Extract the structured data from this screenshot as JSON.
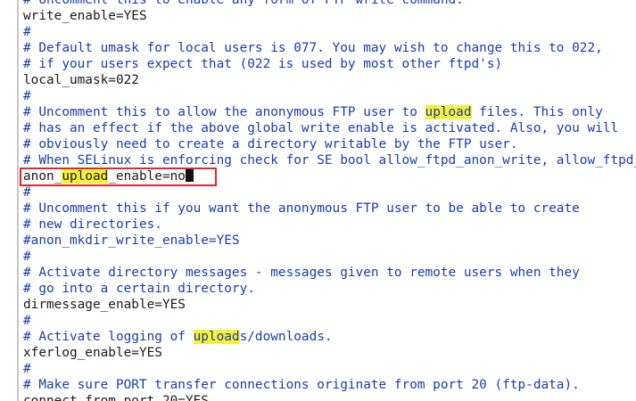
{
  "lines": [
    {
      "type": "comment",
      "segments": [
        {
          "t": "# Uncomment this to enable any form of FTP write command."
        }
      ]
    },
    {
      "type": "code",
      "segments": [
        {
          "t": "write_enable=YES"
        }
      ]
    },
    {
      "type": "comment",
      "segments": [
        {
          "t": "#"
        }
      ]
    },
    {
      "type": "comment",
      "segments": [
        {
          "t": "# Default umask for local users is 077. You may wish to change this to 022,"
        }
      ]
    },
    {
      "type": "comment",
      "segments": [
        {
          "t": "# if your users expect that (022 is used by most other ftpd's)"
        }
      ]
    },
    {
      "type": "code",
      "segments": [
        {
          "t": "local_umask=022"
        }
      ]
    },
    {
      "type": "comment",
      "segments": [
        {
          "t": "#"
        }
      ]
    },
    {
      "type": "comment",
      "segments": [
        {
          "t": "# Uncomment this to allow the anonymous FTP user to "
        },
        {
          "t": "upload",
          "hl": true
        },
        {
          "t": " files. This only"
        }
      ]
    },
    {
      "type": "comment",
      "segments": [
        {
          "t": "# has an effect if the above global write enable is activated. Also, you will"
        }
      ]
    },
    {
      "type": "comment",
      "segments": [
        {
          "t": "# obviously need to create a directory writable by the FTP user."
        }
      ]
    },
    {
      "type": "comment",
      "segments": [
        {
          "t": "# When SELinux is enforcing check for SE bool allow_ftpd_anon_write, allow_ftpd_full_access"
        }
      ]
    },
    {
      "type": "code",
      "segments": [
        {
          "t": "anon_"
        },
        {
          "t": "upload",
          "hl": true
        },
        {
          "t": "_enable=no"
        }
      ],
      "cursor": true
    },
    {
      "type": "comment",
      "segments": [
        {
          "t": "#"
        }
      ]
    },
    {
      "type": "comment",
      "segments": [
        {
          "t": "# Uncomment this if you want the anonymous FTP user to be able to create"
        }
      ]
    },
    {
      "type": "comment",
      "segments": [
        {
          "t": "# new directories."
        }
      ]
    },
    {
      "type": "comment",
      "segments": [
        {
          "t": "#anon_mkdir_write_enable=YES"
        }
      ]
    },
    {
      "type": "comment",
      "segments": [
        {
          "t": "#"
        }
      ]
    },
    {
      "type": "comment",
      "segments": [
        {
          "t": "# Activate directory messages - messages given to remote users when they"
        }
      ]
    },
    {
      "type": "comment",
      "segments": [
        {
          "t": "# go into a certain directory."
        }
      ]
    },
    {
      "type": "code",
      "segments": [
        {
          "t": "dirmessage_enable=YES"
        }
      ]
    },
    {
      "type": "comment",
      "segments": [
        {
          "t": "#"
        }
      ]
    },
    {
      "type": "comment",
      "segments": [
        {
          "t": "# Activate logging of "
        },
        {
          "t": "upload",
          "hl": true
        },
        {
          "t": "s/downloads."
        }
      ]
    },
    {
      "type": "code",
      "segments": [
        {
          "t": "xferlog_enable=YES"
        }
      ]
    },
    {
      "type": "comment",
      "segments": [
        {
          "t": "#"
        }
      ]
    },
    {
      "type": "comment",
      "segments": [
        {
          "t": "# Make sure PORT transfer connections originate from port 20 (ftp-data)."
        }
      ]
    },
    {
      "type": "code",
      "segments": [
        {
          "t": "connect_from_port_20=YES"
        }
      ]
    }
  ],
  "colors": {
    "comment": "#1a3ea8",
    "code": "#1a1a1a",
    "highlight": "#f6f13a",
    "focus_box": "#e0282c"
  }
}
